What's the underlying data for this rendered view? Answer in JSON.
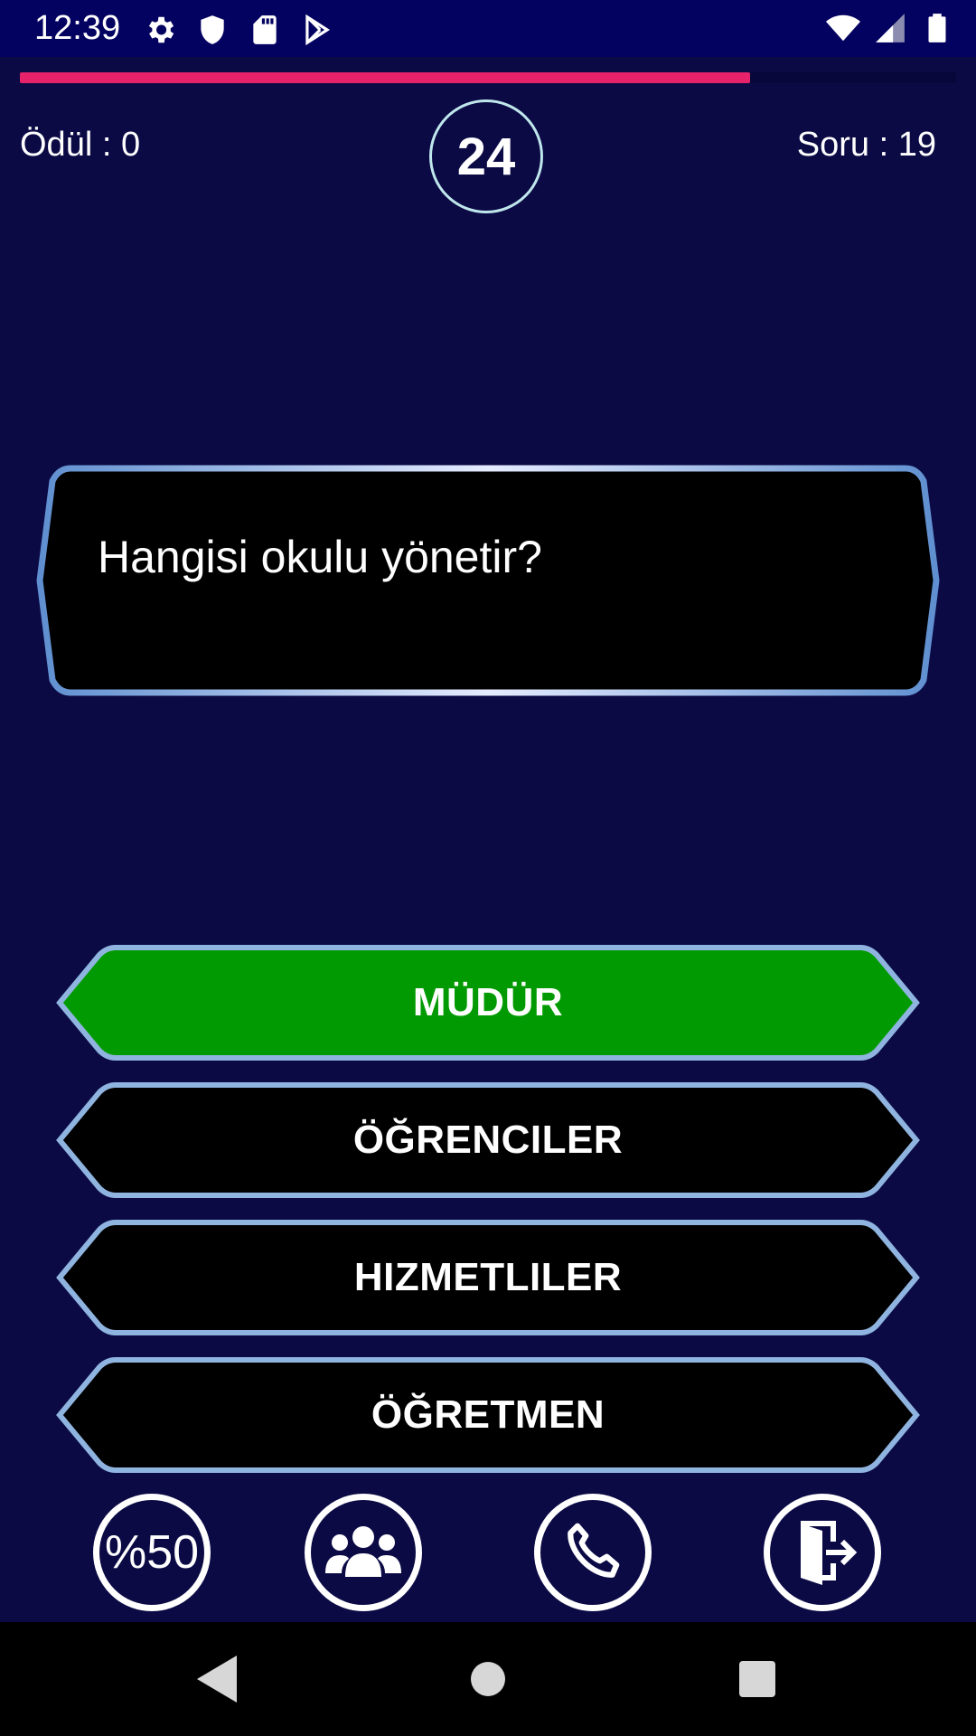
{
  "status_bar": {
    "time": "12:39",
    "left_icons": [
      "settings-icon",
      "shield-icon",
      "sd-card-icon",
      "play-store-icon"
    ],
    "right_icons": [
      "wifi-icon",
      "cell-signal-icon",
      "battery-icon"
    ]
  },
  "game": {
    "progress_fraction": 0.78,
    "reward": "Ödül : 0",
    "timer": "24",
    "question_number": "Soru : 19",
    "question": "Hangisi okulu yönetir?"
  },
  "answers": [
    {
      "label": "MÜDÜR",
      "state": "selected"
    },
    {
      "label": "ÖĞRENCILER",
      "state": "default"
    },
    {
      "label": "HIZMETLILER",
      "state": "default"
    },
    {
      "label": "ÖĞRETMEN",
      "state": "default"
    }
  ],
  "lifelines": {
    "fifty_fifty": "%50",
    "audience": "audience-icon",
    "phone": "phone-icon",
    "exit": "exit-door-icon"
  },
  "nav_bar": [
    "back-icon",
    "home-icon",
    "recents-icon"
  ],
  "colors": {
    "background": "#0b0a45",
    "status_bar": "#040260",
    "progress": "#e5226a",
    "selected_answer": "#029a02",
    "answer_default": "#000000",
    "border": "#7fa8d8"
  }
}
